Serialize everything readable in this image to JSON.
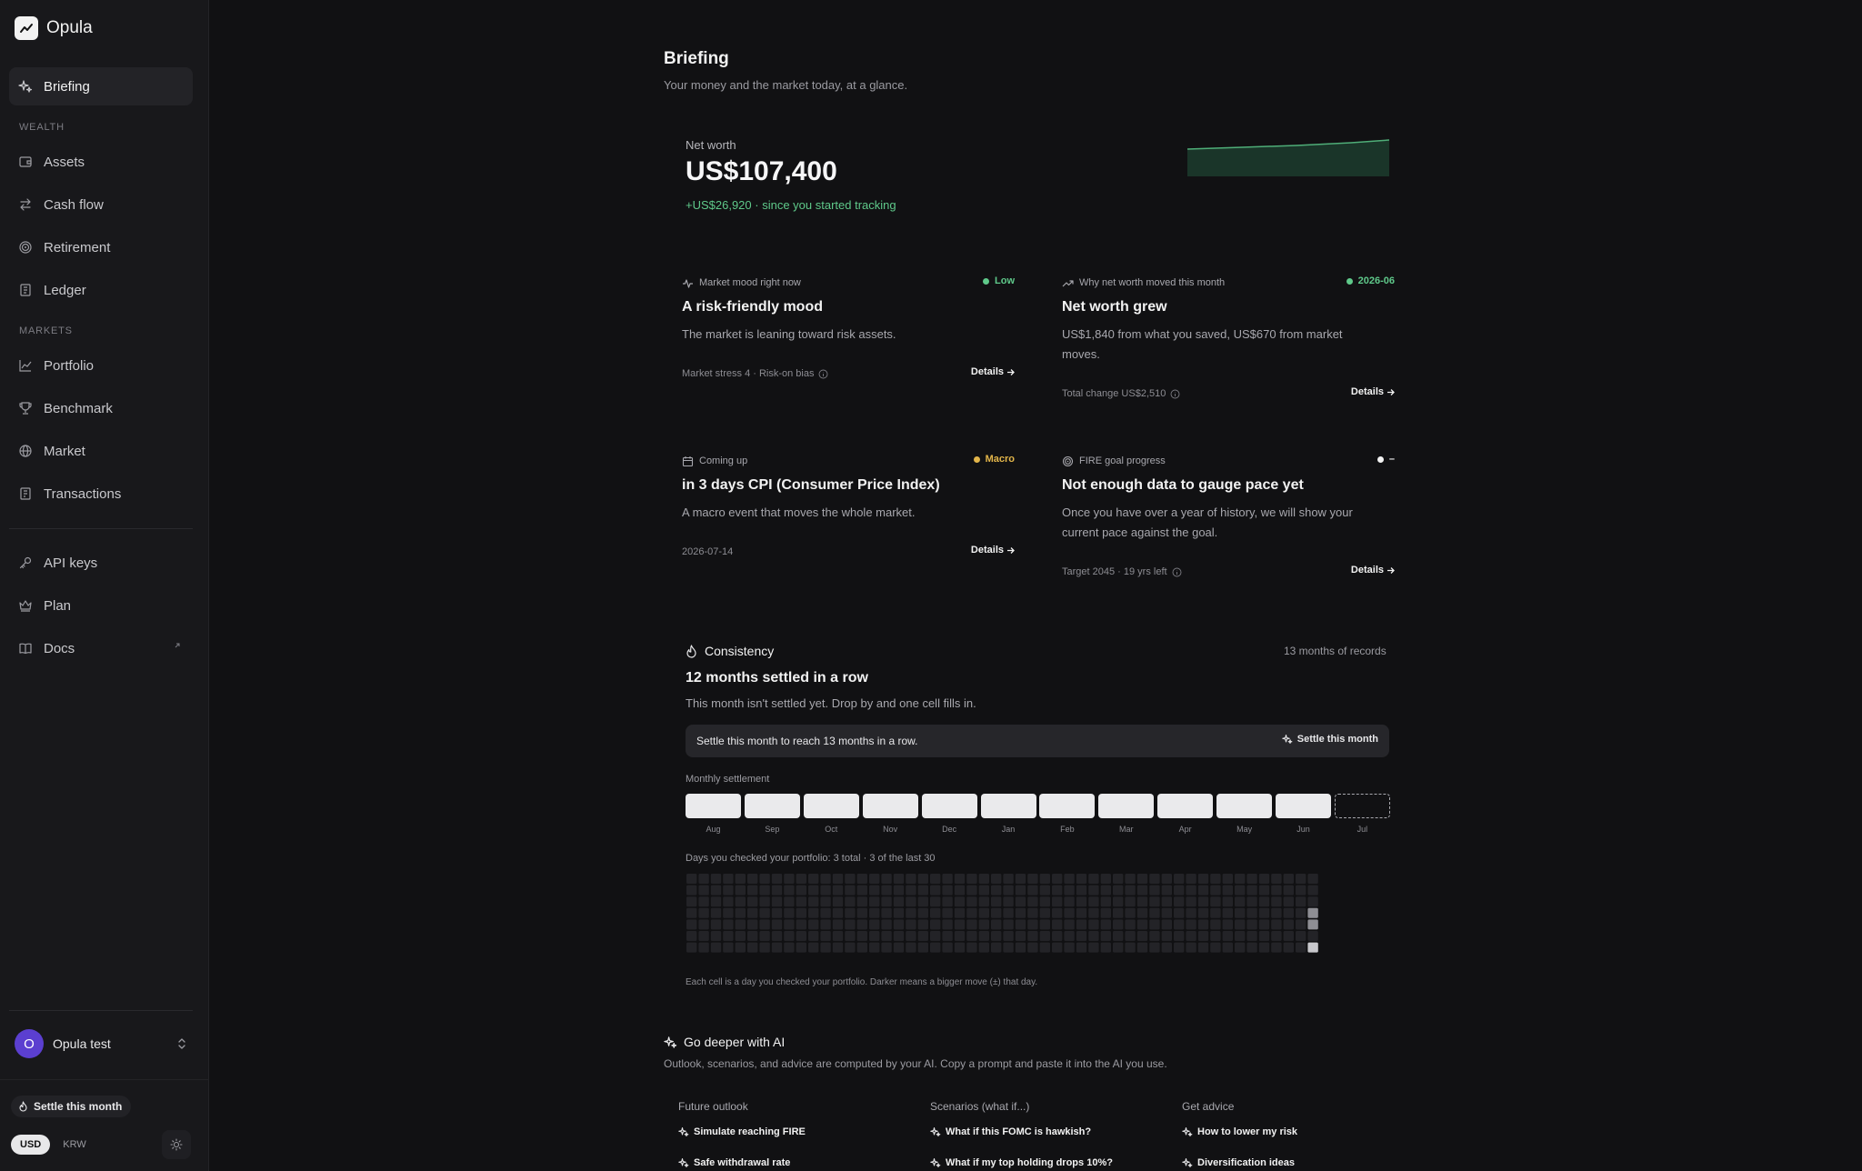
{
  "sidebar": {
    "brand": "Opula",
    "items": [
      {
        "label": "Briefing",
        "icon": "sparkle-icon",
        "active": true
      },
      {
        "label": "Assets",
        "icon": "wallet-icon"
      },
      {
        "label": "Cash flow",
        "icon": "arrows-swap-icon"
      },
      {
        "label": "Retirement",
        "icon": "target-icon"
      },
      {
        "label": "Ledger",
        "icon": "book-icon"
      },
      {
        "label": "Portfolio",
        "icon": "line-chart-icon"
      },
      {
        "label": "Benchmark",
        "icon": "trophy-icon"
      },
      {
        "label": "Market",
        "icon": "globe-icon"
      },
      {
        "label": "Transactions",
        "icon": "receipt-icon"
      },
      {
        "label": "API keys",
        "icon": "key-icon"
      },
      {
        "label": "Plan",
        "icon": "crown-icon"
      },
      {
        "label": "Docs",
        "icon": "book-open-icon"
      }
    ],
    "sections": {
      "wealth": "WEALTH",
      "markets": "MARKETS"
    },
    "user": {
      "initial": "O",
      "name": "Opula test"
    },
    "settle_chip": "Settle this month",
    "currency": {
      "options": [
        "USD",
        "KRW"
      ],
      "selected": "USD"
    }
  },
  "header": {
    "title": "Briefing",
    "subtitle": "Your money and the market today, at a glance."
  },
  "net_worth": {
    "label": "Net worth",
    "value": "US$107,400",
    "change": "+US$26,920 · since you started tracking",
    "accent": "#5fc98a"
  },
  "cards": [
    {
      "head": "Market mood right now",
      "icon": "pulse-icon",
      "tag": "Low",
      "tag_color": "#5fc98a",
      "title": "A risk-friendly mood",
      "body": "The market is leaning toward risk assets.",
      "foot": "Market stress 4 · Risk-on bias",
      "foot_info": true,
      "details": "Details"
    },
    {
      "head": "Why net worth moved this month",
      "icon": "trend-up-icon",
      "tag": "2026-06",
      "tag_color": "#5fc98a",
      "title": "Net worth grew",
      "body": "US$1,840 from what you saved, US$670 from market moves.",
      "foot": "Total change US$2,510",
      "foot_info": true,
      "details": "Details"
    },
    {
      "head": "Coming up",
      "icon": "calendar-icon",
      "tag": "Macro",
      "tag_color": "#e2b54a",
      "title": "in 3 days CPI (Consumer Price Index)",
      "body": "A macro event that moves the whole market.",
      "foot": "2026-07-14",
      "foot_info": false,
      "details": "Details"
    },
    {
      "head": "FIRE goal progress",
      "icon": "target-icon",
      "tag": "–",
      "tag_color": "#f2f2f2",
      "title": "Not enough data to gauge pace yet",
      "body": "Once you have over a year of history, we will show your current pace against the goal.",
      "foot": "Target 2045 · 19 yrs left",
      "foot_info": true,
      "details": "Details"
    }
  ],
  "consistency": {
    "heading": "Consistency",
    "records": "13 months of records",
    "title": "12 months settled in a row",
    "subtitle": "This month isn't settled yet. Drop by and one cell fills in.",
    "banner": "Settle this month to reach 13 months in a row.",
    "banner_button": "Settle this month",
    "monthly_label": "Monthly settlement",
    "months": [
      "Aug",
      "Sep",
      "Oct",
      "Nov",
      "Dec",
      "Jan",
      "Feb",
      "Mar",
      "Apr",
      "May",
      "Jun",
      "Jul"
    ],
    "settled": [
      true,
      true,
      true,
      true,
      true,
      true,
      true,
      true,
      true,
      true,
      true,
      false
    ],
    "days_label": "Days you checked your portfolio: 3 total · 3 of the last 30",
    "heatmap": {
      "weeks": 52,
      "days": 7,
      "checked": [
        {
          "week": 51,
          "day": 3,
          "level": 2
        },
        {
          "week": 51,
          "day": 4,
          "level": 2
        },
        {
          "week": 51,
          "day": 6,
          "level": 3
        }
      ]
    },
    "caption": "Each cell is a day you checked your portfolio. Darker means a bigger move (±) that day."
  },
  "ai": {
    "heading": "Go deeper with AI",
    "subtitle": "Outlook, scenarios, and advice are computed by your AI. Copy a prompt and paste it into the AI you use.",
    "columns": [
      {
        "title": "Future outlook",
        "prompts": [
          "Simulate reaching FIRE",
          "Safe withdrawal rate"
        ]
      },
      {
        "title": "Scenarios (what if...)",
        "prompts": [
          "What if this FOMC is hawkish?",
          "What if my top holding drops 10%?"
        ]
      },
      {
        "title": "Get advice",
        "prompts": [
          "How to lower my risk",
          "Diversification ideas"
        ]
      }
    ]
  }
}
